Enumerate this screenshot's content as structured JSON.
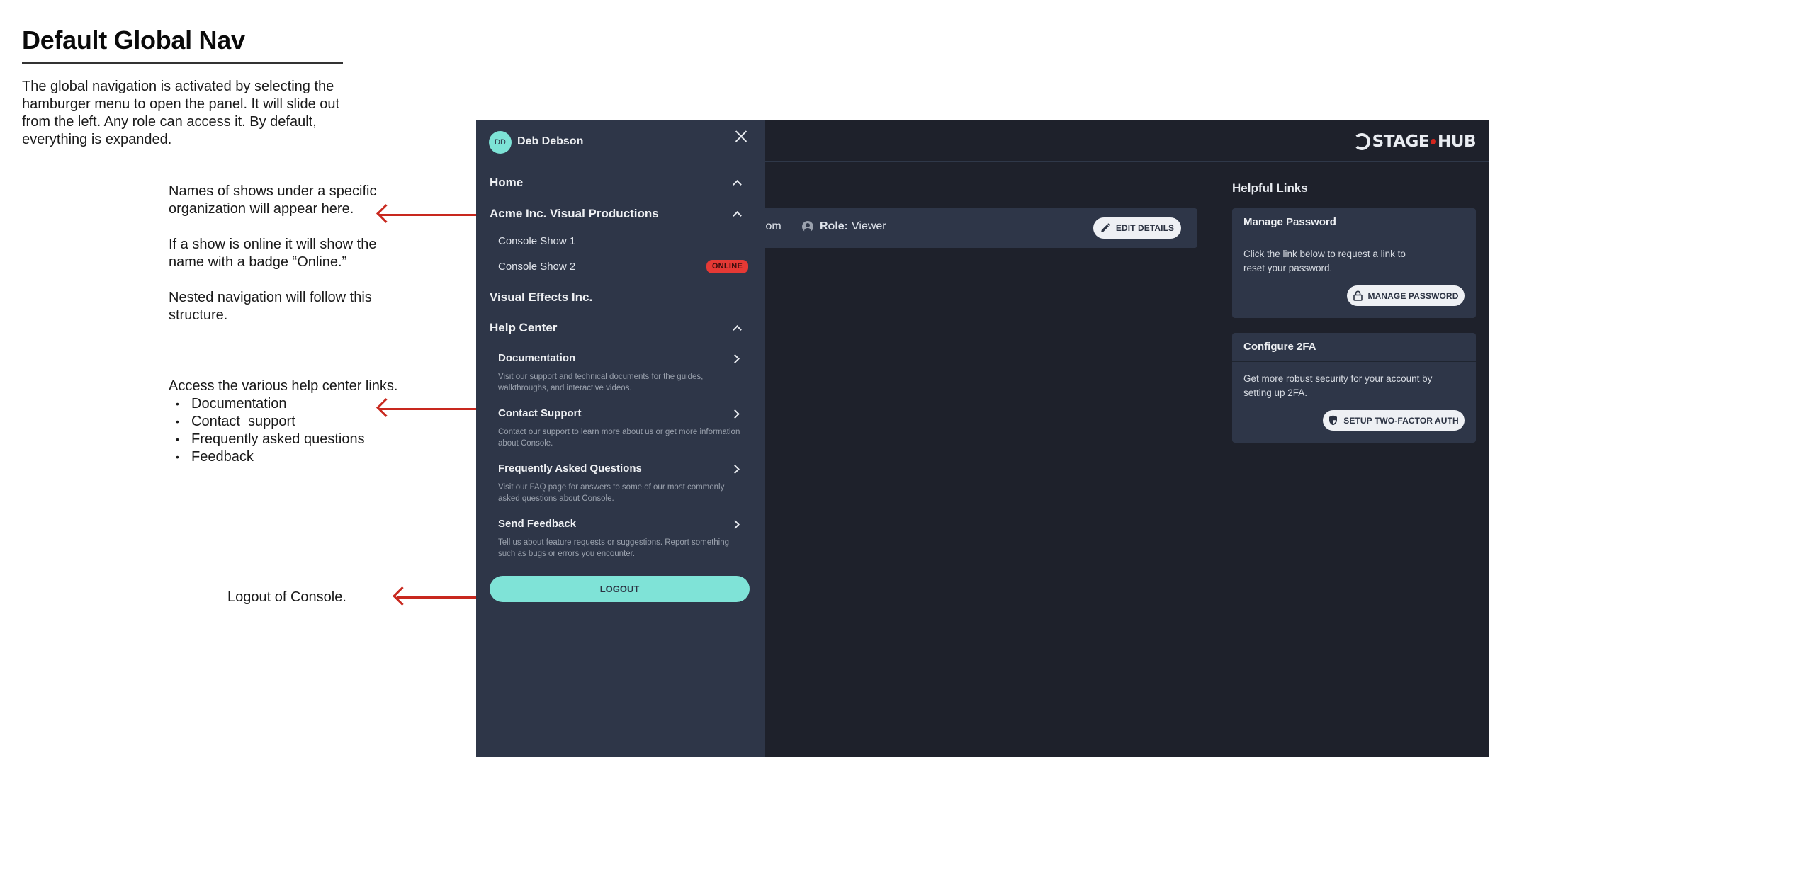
{
  "doc": {
    "title": "Default Global Nav",
    "intro": "The global navigation is activated by selecting the hamburger menu to open the panel. It will slide out from the left. Any role can access it. By default, everything is expanded."
  },
  "annotations": {
    "shows_1": "Names of shows under a specific organization will appear here.",
    "shows_2": "If a show is online it will show the name with a badge “Online.”",
    "shows_3": "Nested navigation will follow this structure.",
    "help_intro": "Access the various help center links.",
    "help_items": [
      "Documentation",
      "Contact  support",
      "Frequently asked questions",
      "Feedback"
    ],
    "logout": "Logout of Console."
  },
  "colors": {
    "annotation_red": "#c8281e",
    "panel_bg": "#2e3648",
    "app_bg": "#1e212b",
    "accent_teal": "#7fe3d7",
    "online_red": "#e53935"
  },
  "app": {
    "logo": {
      "left": "STAGE",
      "right": "HUB",
      "dot_color": "#d3261e"
    },
    "user": {
      "email_fragment": "ail.com",
      "role_label": "Role:",
      "role_value": "Viewer",
      "edit_label": "EDIT DETAILS"
    },
    "helpful_links": {
      "title": "Helpful Links",
      "password": {
        "title": "Manage Password",
        "text": "Click the link below to request a link to  reset your password.",
        "button": "MANAGE PASSWORD"
      },
      "twofa": {
        "title": "Configure 2FA",
        "text": "Get more robust security for your account by setting up 2FA.",
        "button": "SETUP TWO-FACTOR AUTH"
      }
    }
  },
  "nav": {
    "avatar_initials": "DD",
    "user_name": "Deb Debson",
    "home": "Home",
    "org1": {
      "name": "Acme Inc. Visual Productions",
      "shows": [
        {
          "name": "Console Show 1",
          "online": false
        },
        {
          "name": "Console Show 2",
          "online": true
        }
      ],
      "online_badge": "ONLINE"
    },
    "org2": {
      "name": "Visual Effects Inc."
    },
    "help_center": {
      "title": "Help Center",
      "items": [
        {
          "title": "Documentation",
          "desc": "Visit our support and technical documents for the guides, walkthroughs, and interactive videos."
        },
        {
          "title": "Contact Support",
          "desc": "Contact our support to learn more about us or get more information about Console."
        },
        {
          "title": "Frequently Asked Questions",
          "desc": "Visit our FAQ page for answers to some of our most commonly asked questions about Console."
        },
        {
          "title": "Send Feedback",
          "desc": "Tell us about feature requests or suggestions. Report something such as bugs or errors you encounter."
        }
      ]
    },
    "logout": "LOGOUT"
  }
}
